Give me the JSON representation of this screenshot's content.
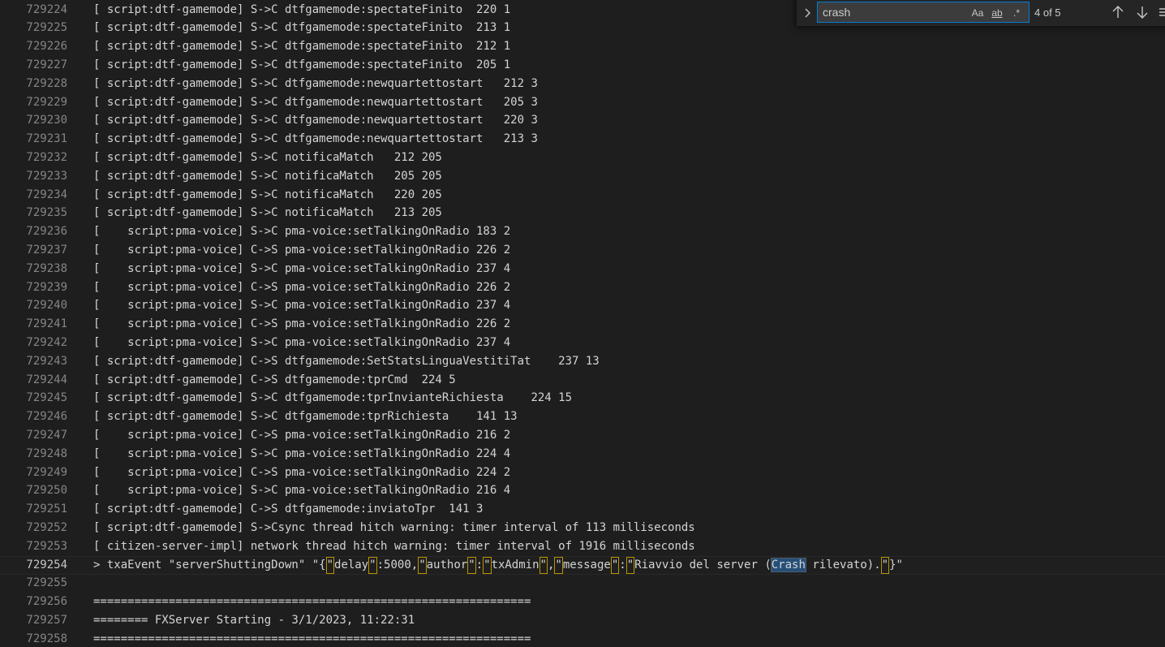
{
  "find": {
    "query": "crash",
    "match_case_label": "Aa",
    "whole_word_label": "ab",
    "regex_label": ".*",
    "count": "4 of 5",
    "expand_icon": "chevron-right-icon",
    "prev_icon": "arrow-up-icon",
    "next_icon": "arrow-down-icon",
    "more_icon": "menu-icon"
  },
  "colors": {
    "background": "#1e1e1e",
    "text": "#d4d4d4",
    "line_number": "#858585",
    "match_highlight": "#264f78",
    "bracket_highlight": "#b89500",
    "find_border": "#007fd4"
  },
  "lines": [
    {
      "n": "729224",
      "t": "[ script:dtf-gamemode] S->C dtfgamemode:spectateFinito  220 1"
    },
    {
      "n": "729225",
      "t": "[ script:dtf-gamemode] S->C dtfgamemode:spectateFinito  213 1"
    },
    {
      "n": "729226",
      "t": "[ script:dtf-gamemode] S->C dtfgamemode:spectateFinito  212 1"
    },
    {
      "n": "729227",
      "t": "[ script:dtf-gamemode] S->C dtfgamemode:spectateFinito  205 1"
    },
    {
      "n": "729228",
      "t": "[ script:dtf-gamemode] S->C dtfgamemode:newquartettostart   212 3"
    },
    {
      "n": "729229",
      "t": "[ script:dtf-gamemode] S->C dtfgamemode:newquartettostart   205 3"
    },
    {
      "n": "729230",
      "t": "[ script:dtf-gamemode] S->C dtfgamemode:newquartettostart   220 3"
    },
    {
      "n": "729231",
      "t": "[ script:dtf-gamemode] S->C dtfgamemode:newquartettostart   213 3"
    },
    {
      "n": "729232",
      "t": "[ script:dtf-gamemode] S->C notificaMatch   212 205"
    },
    {
      "n": "729233",
      "t": "[ script:dtf-gamemode] S->C notificaMatch   205 205"
    },
    {
      "n": "729234",
      "t": "[ script:dtf-gamemode] S->C notificaMatch   220 205"
    },
    {
      "n": "729235",
      "t": "[ script:dtf-gamemode] S->C notificaMatch   213 205"
    },
    {
      "n": "729236",
      "t": "[    script:pma-voice] S->C pma-voice:setTalkingOnRadio 183 2"
    },
    {
      "n": "729237",
      "t": "[    script:pma-voice] C->S pma-voice:setTalkingOnRadio 226 2"
    },
    {
      "n": "729238",
      "t": "[    script:pma-voice] S->C pma-voice:setTalkingOnRadio 237 4"
    },
    {
      "n": "729239",
      "t": "[    script:pma-voice] C->S pma-voice:setTalkingOnRadio 226 2"
    },
    {
      "n": "729240",
      "t": "[    script:pma-voice] S->C pma-voice:setTalkingOnRadio 237 4"
    },
    {
      "n": "729241",
      "t": "[    script:pma-voice] C->S pma-voice:setTalkingOnRadio 226 2"
    },
    {
      "n": "729242",
      "t": "[    script:pma-voice] S->C pma-voice:setTalkingOnRadio 237 4"
    },
    {
      "n": "729243",
      "t": "[ script:dtf-gamemode] C->S dtfgamemode:SetStatsLinguaVestitiTat    237 13"
    },
    {
      "n": "729244",
      "t": "[ script:dtf-gamemode] C->S dtfgamemode:tprCmd  224 5"
    },
    {
      "n": "729245",
      "t": "[ script:dtf-gamemode] S->C dtfgamemode:tprInvianteRichiesta    224 15"
    },
    {
      "n": "729246",
      "t": "[ script:dtf-gamemode] S->C dtfgamemode:tprRichiesta    141 13"
    },
    {
      "n": "729247",
      "t": "[    script:pma-voice] C->S pma-voice:setTalkingOnRadio 216 2"
    },
    {
      "n": "729248",
      "t": "[    script:pma-voice] S->C pma-voice:setTalkingOnRadio 224 4"
    },
    {
      "n": "729249",
      "t": "[    script:pma-voice] C->S pma-voice:setTalkingOnRadio 224 2"
    },
    {
      "n": "729250",
      "t": "[    script:pma-voice] S->C pma-voice:setTalkingOnRadio 216 4"
    },
    {
      "n": "729251",
      "t": "[ script:dtf-gamemode] C->S dtfgamemode:inviatoTpr  141 3"
    },
    {
      "n": "729252",
      "t": "[ script:dtf-gamemode] S->Csync thread hitch warning: timer interval of 113 milliseconds"
    },
    {
      "n": "729253",
      "t": "[ citizen-server-impl] network thread hitch warning: timer interval of 1916 milliseconds"
    },
    {
      "n": "729254",
      "segments": [
        {
          "t": "> txaEvent \"serverShuttingDown\" \"{"
        },
        {
          "t": "\"",
          "q": 1
        },
        {
          "t": "delay"
        },
        {
          "t": "\"",
          "q": 1
        },
        {
          "t": ":5000,"
        },
        {
          "t": "\"",
          "q": 1
        },
        {
          "t": "author"
        },
        {
          "t": "\"",
          "q": 1
        },
        {
          "t": ":"
        },
        {
          "t": "\"",
          "q": 1
        },
        {
          "t": "txAdmin"
        },
        {
          "t": "\"",
          "q": 1
        },
        {
          "t": ","
        },
        {
          "t": "\"",
          "q": 1
        },
        {
          "t": "message"
        },
        {
          "t": "\"",
          "q": 1
        },
        {
          "t": ":"
        },
        {
          "t": "\"",
          "q": 1
        },
        {
          "t": "Riavvio del server ("
        },
        {
          "t": "Crash",
          "hit": 1
        },
        {
          "t": " rilevato)."
        },
        {
          "t": "\"",
          "q": 1
        },
        {
          "t": "}\""
        }
      ]
    },
    {
      "n": "729255",
      "t": ""
    },
    {
      "n": "729256",
      "t": "================================================================"
    },
    {
      "n": "729257",
      "t": "======== FXServer Starting - 3/1/2023, 11:22:31"
    },
    {
      "n": "729258",
      "t": "================================================================"
    }
  ]
}
